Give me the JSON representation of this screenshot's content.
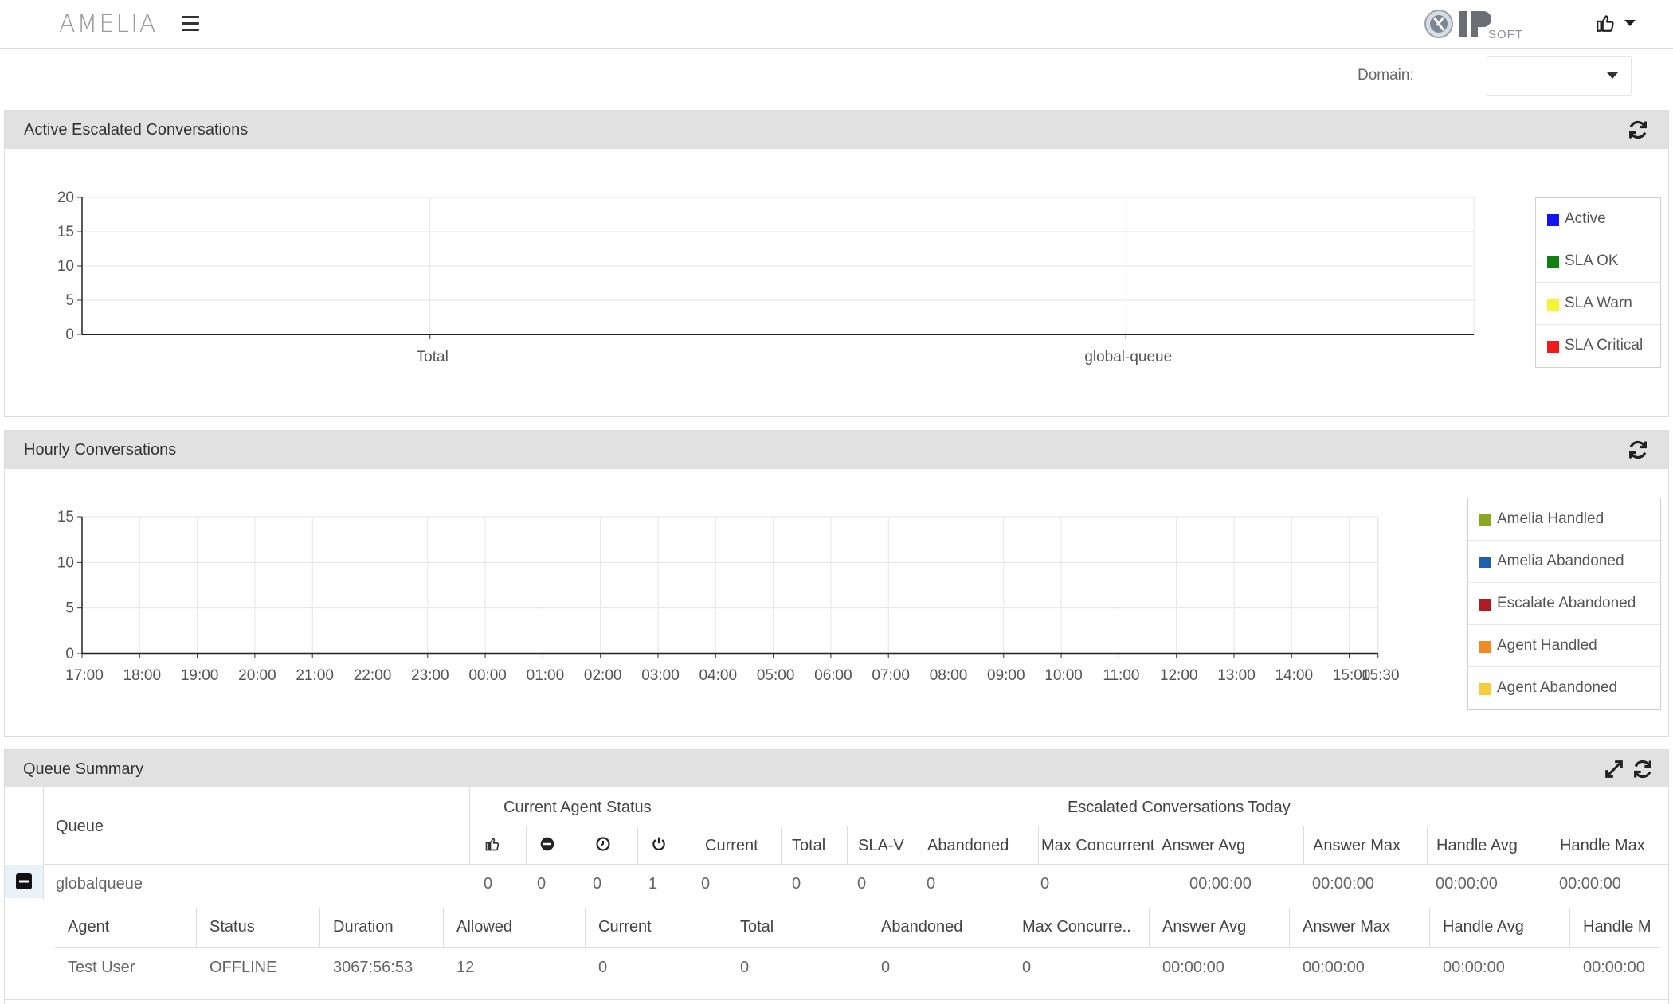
{
  "app": {
    "logo": "AMELIA",
    "vendor_logo": "IPSOFT"
  },
  "domain": {
    "label": "Domain:",
    "value": ""
  },
  "panels": {
    "active": {
      "title": "Active Escalated Conversations"
    },
    "hourly": {
      "title": "Hourly Conversations"
    },
    "queue": {
      "title": "Queue Summary"
    }
  },
  "chart_data": [
    {
      "type": "bar",
      "categories": [
        "Total",
        "global-queue"
      ],
      "series": [
        {
          "name": "Active",
          "values": [
            0,
            0
          ],
          "color": "#1414f0"
        },
        {
          "name": "SLA OK",
          "values": [
            0,
            0
          ],
          "color": "#108010"
        },
        {
          "name": "SLA Warn",
          "values": [
            0,
            0
          ],
          "color": "#f4f430"
        },
        {
          "name": "SLA Critical",
          "values": [
            0,
            0
          ],
          "color": "#f01818"
        }
      ],
      "ylim": [
        0,
        20
      ],
      "yticks": [
        0,
        5,
        10,
        15,
        20
      ],
      "legend": "right",
      "grid": true
    },
    {
      "type": "line",
      "x": [
        "17:00",
        "18:00",
        "19:00",
        "20:00",
        "21:00",
        "22:00",
        "23:00",
        "00:00",
        "01:00",
        "02:00",
        "03:00",
        "04:00",
        "05:00",
        "06:00",
        "07:00",
        "08:00",
        "09:00",
        "10:00",
        "11:00",
        "12:00",
        "13:00",
        "14:00",
        "15:00",
        "15:30"
      ],
      "series": [
        {
          "name": "Amelia Handled",
          "values": [
            0,
            0,
            0,
            0,
            0,
            0,
            0,
            0,
            0,
            0,
            0,
            0,
            0,
            0,
            0,
            0,
            0,
            0,
            0,
            0,
            0,
            0,
            0,
            0
          ],
          "color": "#8aa824"
        },
        {
          "name": "Amelia Abandoned",
          "values": [
            0,
            0,
            0,
            0,
            0,
            0,
            0,
            0,
            0,
            0,
            0,
            0,
            0,
            0,
            0,
            0,
            0,
            0,
            0,
            0,
            0,
            0,
            0,
            0
          ],
          "color": "#1f5fae"
        },
        {
          "name": "Escalate Abandoned",
          "values": [
            0,
            0,
            0,
            0,
            0,
            0,
            0,
            0,
            0,
            0,
            0,
            0,
            0,
            0,
            0,
            0,
            0,
            0,
            0,
            0,
            0,
            0,
            0,
            0
          ],
          "color": "#b01c24"
        },
        {
          "name": "Agent Handled",
          "values": [
            0,
            0,
            0,
            0,
            0,
            0,
            0,
            0,
            0,
            0,
            0,
            0,
            0,
            0,
            0,
            0,
            0,
            0,
            0,
            0,
            0,
            0,
            0,
            0
          ],
          "color": "#f08a24"
        },
        {
          "name": "Agent Abandoned",
          "values": [
            0,
            0,
            0,
            0,
            0,
            0,
            0,
            0,
            0,
            0,
            0,
            0,
            0,
            0,
            0,
            0,
            0,
            0,
            0,
            0,
            0,
            0,
            0,
            0
          ],
          "color": "#f4cc3c"
        }
      ],
      "ylim": [
        0,
        15
      ],
      "yticks": [
        0,
        5,
        10,
        15
      ],
      "legend": "right",
      "grid": true
    }
  ],
  "queue_table": {
    "queue_header": "Queue",
    "agent_status_group": "Current Agent Status",
    "escalated_group": "Escalated Conversations Today",
    "status_icons": [
      "thumbs-up-icon",
      "minus-circle-icon",
      "clock-icon",
      "power-icon"
    ],
    "columns": [
      "Current",
      "Total",
      "SLA-V",
      "Abandoned",
      "Max Concurrent",
      "Answer Avg",
      "Answer Max",
      "Handle Avg",
      "Handle Max"
    ],
    "row": {
      "name": "globalqueue",
      "status_counts": [
        "0",
        "0",
        "0",
        "1"
      ],
      "values": [
        "0",
        "0",
        "0",
        "0",
        "0",
        "00:00:00",
        "00:00:00",
        "00:00:00",
        "00:00:00"
      ]
    },
    "agent_columns": [
      "Agent",
      "Status",
      "Duration",
      "Allowed",
      "Current",
      "Total",
      "Abandoned",
      "Max Concurre..",
      "Answer Avg",
      "Answer Max",
      "Handle Avg",
      "Handle M"
    ],
    "agent_rows": [
      [
        "Test User",
        "OFFLINE",
        "3067:56:53",
        "12",
        "0",
        "0",
        "0",
        "0",
        "00:00:00",
        "00:00:00",
        "00:00:00",
        "00:00:00"
      ]
    ]
  }
}
